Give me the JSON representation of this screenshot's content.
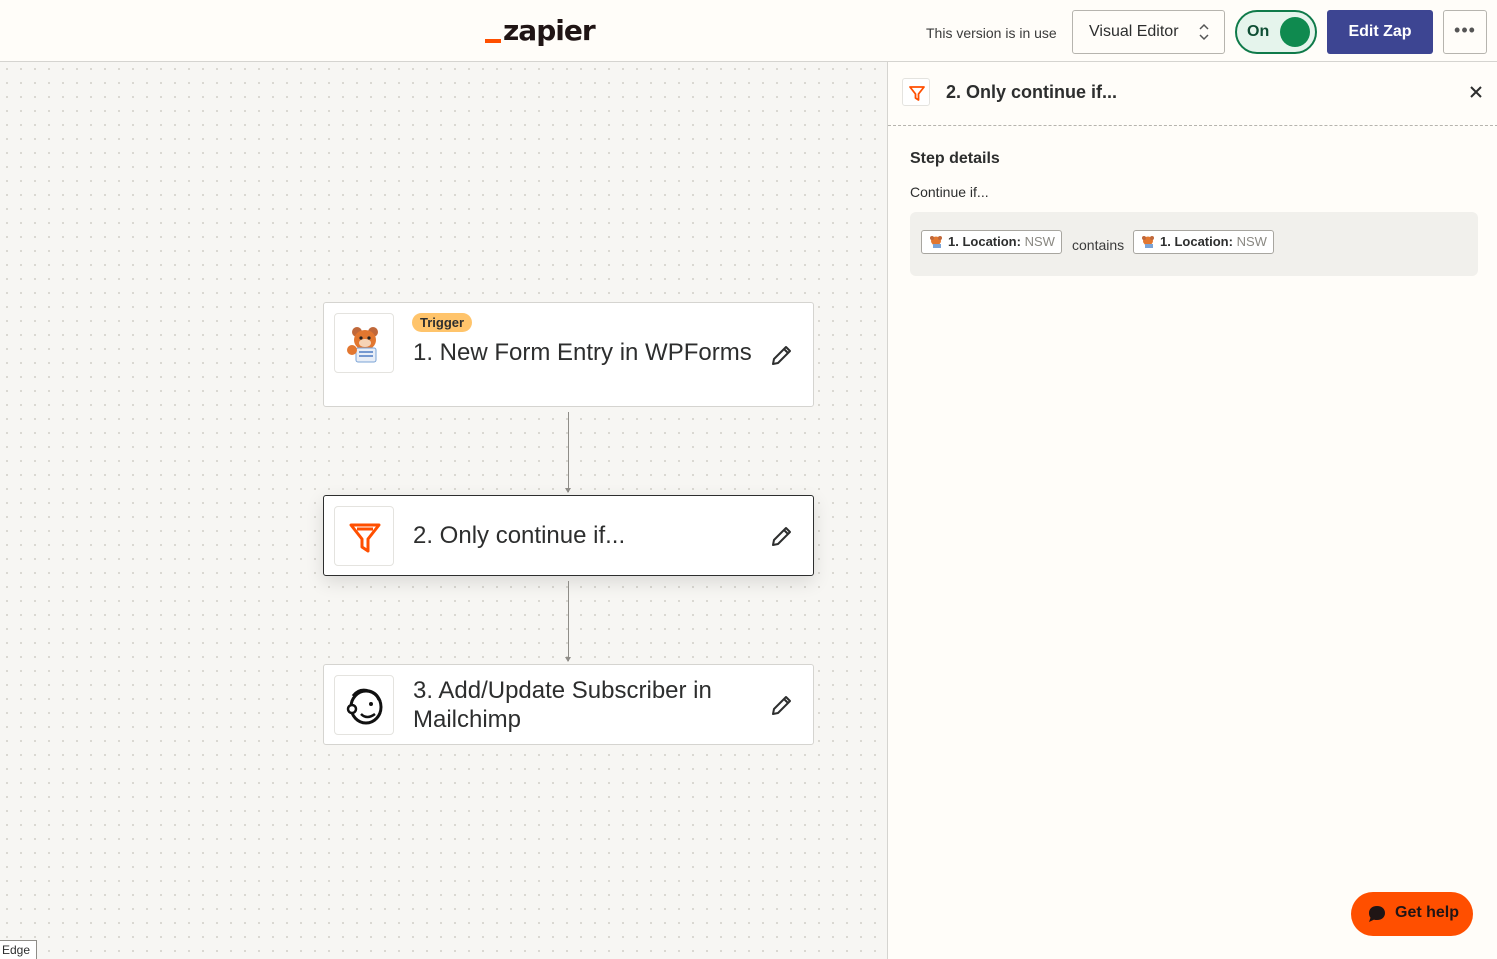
{
  "header": {
    "logo_text": "zapier",
    "version_status": "This version is in use",
    "editor_mode": "Visual Editor",
    "toggle_label": "On",
    "edit_button": "Edit Zap",
    "more_label": "•••"
  },
  "steps": [
    {
      "badge": "Trigger",
      "title": "1. New Form Entry in WPForms",
      "icon": "wpforms-bear-icon"
    },
    {
      "title": "2. Only continue if...",
      "icon": "filter-icon",
      "active": true
    },
    {
      "title": "3. Add/Update Subscriber in Mailchimp",
      "icon": "mailchimp-icon"
    }
  ],
  "panel": {
    "title": "2. Only continue if...",
    "section_title": "Step details",
    "continue_label": "Continue if...",
    "condition": {
      "left": {
        "key": "1. Location:",
        "value": "NSW"
      },
      "operator": "contains",
      "right": {
        "key": "1. Location:",
        "value": "NSW"
      }
    }
  },
  "help_button": "Get help",
  "edge_tag": "Edge",
  "colors": {
    "brand_orange": "#ff4f00",
    "edit_button": "#3d4592",
    "toggle_on": "#0f8a4f",
    "trigger_badge": "#ffc46b"
  }
}
